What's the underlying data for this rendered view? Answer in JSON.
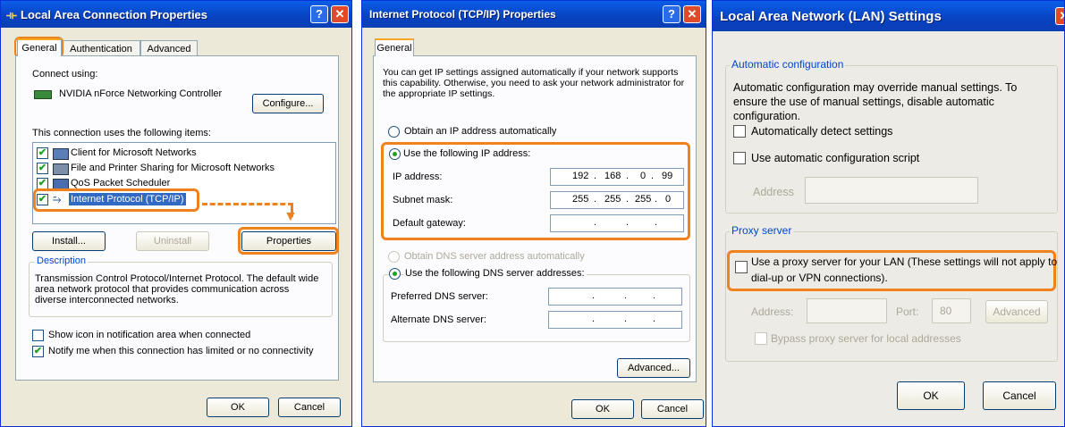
{
  "win1": {
    "title": "Local Area Connection Properties",
    "tabs": [
      "General",
      "Authentication",
      "Advanced"
    ],
    "connect_using_label": "Connect using:",
    "adapter_name": "NVIDIA nForce Networking Controller",
    "configure_label": "Configure...",
    "items_label": "This connection uses the following items:",
    "items": [
      {
        "label": "Client for Microsoft Networks",
        "checked": true,
        "icon": "network-client-icon"
      },
      {
        "label": "File and Printer Sharing for Microsoft Networks",
        "checked": true,
        "icon": "printer-sharing-icon"
      },
      {
        "label": "QoS Packet Scheduler",
        "checked": true,
        "icon": "qos-icon"
      },
      {
        "label": "Internet Protocol (TCP/IP)",
        "checked": true,
        "icon": "protocol-icon",
        "selected": true
      }
    ],
    "install_label": "Install...",
    "uninstall_label": "Uninstall",
    "properties_label": "Properties",
    "description_label": "Description",
    "description_text": "Transmission Control Protocol/Internet Protocol. The default wide area network protocol that provides communication across diverse interconnected networks.",
    "show_icon_label": "Show icon in notification area when connected",
    "notify_label": "Notify me when this connection has limited or no connectivity",
    "ok_label": "OK",
    "cancel_label": "Cancel"
  },
  "win2": {
    "title": "Internet Protocol (TCP/IP) Properties",
    "tab": "General",
    "intro": "You can get IP settings assigned automatically if your network supports this capability. Otherwise, you need to ask your network administrator for the appropriate IP settings.",
    "obtain_ip_label": "Obtain an IP address automatically",
    "use_ip_label": "Use the following IP address:",
    "ip_label": "IP address:",
    "ip_value": [
      "192",
      "168",
      "0",
      "99"
    ],
    "mask_label": "Subnet mask:",
    "mask_value": [
      "255",
      "255",
      "255",
      "0"
    ],
    "gateway_label": "Default gateway:",
    "obtain_dns_label": "Obtain DNS server address automatically",
    "use_dns_label": "Use the following DNS server addresses:",
    "preferred_dns_label": "Preferred DNS server:",
    "alternate_dns_label": "Alternate DNS server:",
    "advanced_label": "Advanced...",
    "ok_label": "OK",
    "cancel_label": "Cancel"
  },
  "win3": {
    "title": "Local Area Network (LAN) Settings",
    "auto_config_label": "Automatic configuration",
    "auto_config_text": "Automatic configuration may override manual settings.  To ensure the use of manual settings, disable automatic configuration.",
    "auto_detect_label": "Automatically detect settings",
    "auto_script_label": "Use automatic configuration script",
    "address_label": "Address",
    "proxy_label": "Proxy server",
    "use_proxy_label_1": "Use a proxy server for your LAN (These settings will not apply to",
    "use_proxy_label_2": "dial-up or VPN connections).",
    "proxy_address_label": "Address:",
    "port_label": "Port:",
    "port_value": "80",
    "advanced_label": "Advanced",
    "bypass_label": "Bypass proxy server for local addresses",
    "ok_label": "OK",
    "cancel_label": "Cancel"
  },
  "colors": {
    "titlebar": "#0842c0",
    "highlight": "#f0821e",
    "dialog_bg": "#ece9d8",
    "group_label": "#0046d5"
  }
}
